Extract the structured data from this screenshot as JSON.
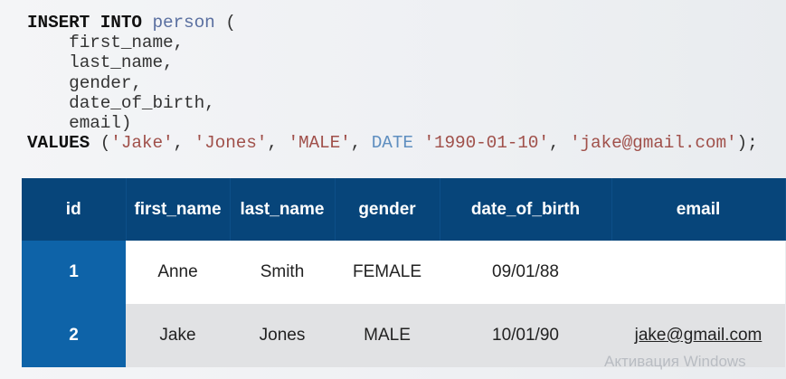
{
  "code": {
    "line1_kw": "INSERT INTO",
    "line1_table": "person",
    "line1_paren": " (",
    "columns": [
      "first_name,",
      "last_name,",
      "gender,",
      "date_of_birth,",
      "email)"
    ],
    "values_kw": "VALUES",
    "open": " (",
    "v1": "'Jake'",
    "v2": "'Jones'",
    "v3": "'MALE'",
    "date_kw": "DATE",
    "v4": "'1990-01-10'",
    "v5": "'jake@gmail.com'",
    "close": ");"
  },
  "table": {
    "headers": [
      "id",
      "first_name",
      "last_name",
      "gender",
      "date_of_birth",
      "email"
    ],
    "rows": [
      [
        "1",
        "Anne",
        "Smith",
        "FEMALE",
        "09/01/88",
        ""
      ],
      [
        "2",
        "Jake",
        "Jones",
        "MALE",
        "10/01/90",
        "jake@gmail.com"
      ]
    ]
  },
  "watermark": "Активация Windows"
}
